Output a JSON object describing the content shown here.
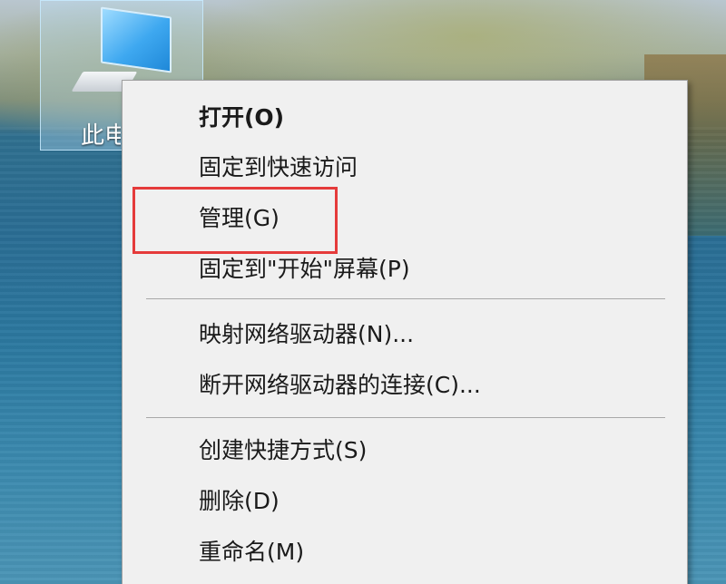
{
  "desktop": {
    "icon": {
      "label": "此电脑",
      "icon_name": "computer-icon"
    }
  },
  "context_menu": {
    "groups": [
      {
        "items": [
          {
            "label": "打开(O)",
            "bold": true
          },
          {
            "label": "固定到快速访问"
          },
          {
            "label": "管理(G)",
            "annotated": true
          },
          {
            "label": "固定到\"开始\"屏幕(P)"
          }
        ]
      },
      {
        "items": [
          {
            "label": "映射网络驱动器(N)..."
          },
          {
            "label": "断开网络驱动器的连接(C)..."
          }
        ]
      },
      {
        "items": [
          {
            "label": "创建快捷方式(S)"
          },
          {
            "label": "删除(D)"
          },
          {
            "label": "重命名(M)"
          }
        ]
      }
    ]
  },
  "annotation": {
    "color": "#e53b3b"
  }
}
